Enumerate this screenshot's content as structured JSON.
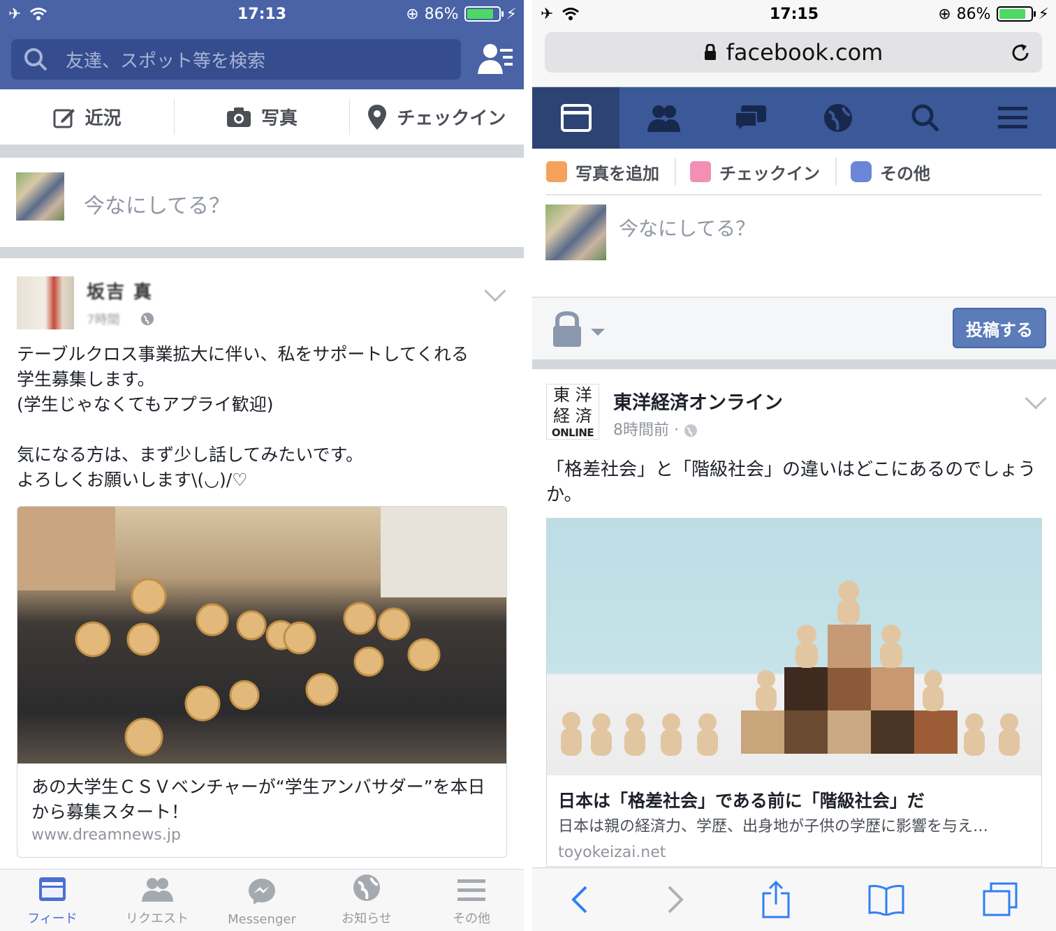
{
  "left": {
    "status": {
      "time": "17:13",
      "battery": "86%"
    },
    "search": {
      "placeholder": "友達、スポット等を検索"
    },
    "composer_actions": [
      "近況",
      "写真",
      "チェックイン"
    ],
    "status_placeholder": "今なにしてる？",
    "post": {
      "author": "坂吉 真",
      "time": "7時間",
      "body": "テーブルクロス事業拡大に伴い、私をサポートしてくれる\n学生募集します。\n(学生じゃなくてもアプライ歓迎)\n\n気になる方は、まず少し話してみたいです。\nよろしくお願いします\\(◡)/♡",
      "link_title": "あの大学生ＣＳＶベンチャーが“学生アンバサダー”を本日から募集スタート！",
      "link_url": "www.dreamnews.jp"
    },
    "tabs": [
      "フィード",
      "リクエスト",
      "Messenger",
      "お知らせ",
      "その他"
    ],
    "colors": {
      "header": "#4a62a6",
      "accent": "#4b70d4"
    }
  },
  "right": {
    "status": {
      "time": "17:15",
      "battery": "86%"
    },
    "url": "facebook.com",
    "actions": [
      "写真を追加",
      "チェックイン",
      "その他"
    ],
    "status_placeholder": "今なにしてる？",
    "post_button": "投稿する",
    "post": {
      "logo_lines": [
        "東 洋",
        "経 済",
        "ONLINE"
      ],
      "author": "東洋経済オンライン",
      "time": "8時間前 ·",
      "body": "「格差社会」と「階級社会」の違いはどこにあるのでしょうか。",
      "link_title": "日本は「格差社会」である前に「階級社会」だ",
      "link_desc": "日本は親の経済力、学歴、出身地が子供の学歴に影響を与え…",
      "link_url": "toyokeizai.net"
    },
    "colors": {
      "fbnav": "#3b5998",
      "post_button": "#5b7bb9"
    }
  }
}
